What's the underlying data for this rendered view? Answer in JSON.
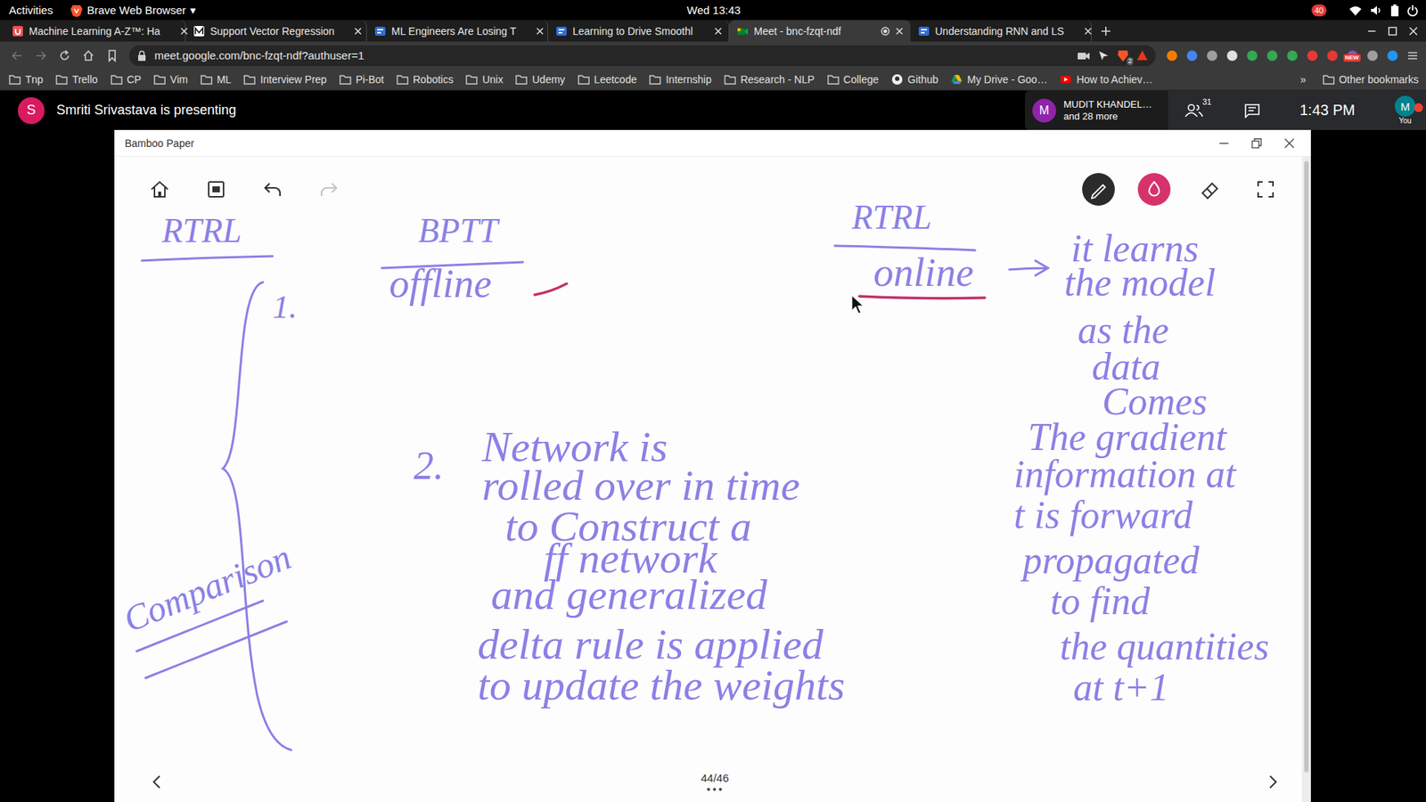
{
  "system_bar": {
    "activities": "Activities",
    "app": "Brave Web Browser",
    "app_arrow": "▾",
    "clock": "Wed 13:43",
    "notification_count": "40"
  },
  "tabs": [
    {
      "label": "Machine Learning A-Z™: Ha",
      "kind": "udemy",
      "selected": false,
      "media_indicator": false
    },
    {
      "label": "Support Vector Regression",
      "kind": "medium",
      "selected": false,
      "media_indicator": false
    },
    {
      "label": "ML Engineers Are Losing T",
      "kind": "av",
      "selected": false,
      "media_indicator": false
    },
    {
      "label": "Learning to Drive Smoothl",
      "kind": "av",
      "selected": false,
      "media_indicator": false
    },
    {
      "label": "Meet - bnc-fzqt-ndf",
      "kind": "meet",
      "selected": true,
      "media_indicator": true
    },
    {
      "label": "Understanding RNN and LS",
      "kind": "av",
      "selected": false,
      "media_indicator": false
    }
  ],
  "address": {
    "url": "meet.google.com/bnc-fzqt-ndf?authuser=1",
    "shield_count": "2",
    "extension_badge": "NEW"
  },
  "bookmarks": [
    {
      "label": "Tnp",
      "kind": "folder"
    },
    {
      "label": "Trello",
      "kind": "folder"
    },
    {
      "label": "CP",
      "kind": "folder"
    },
    {
      "label": "Vim",
      "kind": "folder"
    },
    {
      "label": "ML",
      "kind": "folder"
    },
    {
      "label": "Interview Prep",
      "kind": "folder"
    },
    {
      "label": "Pi-Bot",
      "kind": "folder"
    },
    {
      "label": "Robotics",
      "kind": "folder"
    },
    {
      "label": "Unix",
      "kind": "folder"
    },
    {
      "label": "Udemy",
      "kind": "folder"
    },
    {
      "label": "Leetcode",
      "kind": "folder"
    },
    {
      "label": "Internship",
      "kind": "folder"
    },
    {
      "label": "Research - NLP",
      "kind": "folder"
    },
    {
      "label": "College",
      "kind": "folder"
    },
    {
      "label": "Github",
      "kind": "github"
    },
    {
      "label": "My Drive - Goo…",
      "kind": "drive"
    },
    {
      "label": "How to Achiev…",
      "kind": "youtube"
    }
  ],
  "bookmarks_more": "»",
  "other_bookmarks": "Other bookmarks",
  "meet": {
    "presenter_initial": "S",
    "presenting": "Smriti Srivastava is presenting",
    "participant_initial": "M",
    "participant_name": "MUDIT KHANDEL…",
    "participant_more": "and 28 more",
    "people_count": "31",
    "time": "1:43 PM",
    "self_initial": "M",
    "self_label": "You"
  },
  "app_window": {
    "title": "Bamboo Paper",
    "page": "44/46"
  },
  "ink": [
    {
      "text": "RTRL"
    },
    {
      "text": "BPTT"
    },
    {
      "text": "offline"
    },
    {
      "text": "RTRL"
    },
    {
      "text": "online"
    },
    {
      "text": "it learns"
    },
    {
      "text": "the model"
    },
    {
      "text": "as the"
    },
    {
      "text": "data"
    },
    {
      "text": "Comes"
    },
    {
      "text": "The gradient"
    },
    {
      "text": "information at"
    },
    {
      "text": "t is forward"
    },
    {
      "text": "propagated"
    },
    {
      "text": "to find"
    },
    {
      "text": "the quantities"
    },
    {
      "text": "at t+1"
    },
    {
      "text": "1."
    },
    {
      "text": "2."
    },
    {
      "text": "Network is"
    },
    {
      "text": "rolled over in time"
    },
    {
      "text": "to Construct a"
    },
    {
      "text": "ff network"
    },
    {
      "text": "and generalized"
    },
    {
      "text": "delta rule is applied"
    },
    {
      "text": "to update the weights"
    },
    {
      "text": "Comparison"
    }
  ]
}
